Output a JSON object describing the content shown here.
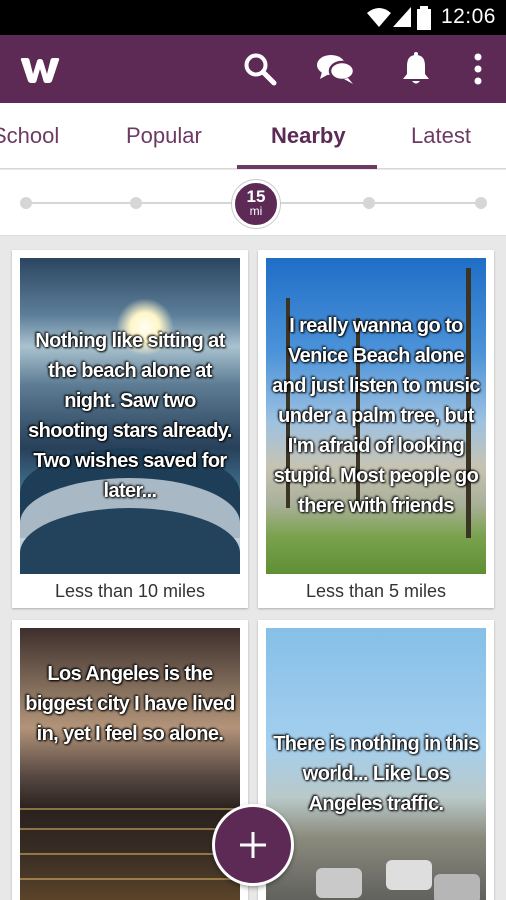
{
  "status_bar": {
    "time": "12:06",
    "icons": [
      "wifi-icon",
      "cellular-signal-icon",
      "battery-icon"
    ]
  },
  "app_bar": {
    "logo": "whisper-w-logo",
    "color": "#5d2a56",
    "actions": [
      {
        "icon": "search-icon"
      },
      {
        "icon": "chat-bubbles-icon"
      },
      {
        "icon": "bell-icon"
      },
      {
        "icon": "more-vertical-icon"
      }
    ]
  },
  "tabs": {
    "items": [
      {
        "label": "School"
      },
      {
        "label": "Popular"
      },
      {
        "label": "Nearby"
      },
      {
        "label": "Latest"
      }
    ],
    "selected": "Nearby"
  },
  "distance_slider": {
    "value": "15",
    "unit": "mi",
    "selected_stop": 3,
    "stop_count": 6
  },
  "feed": {
    "cards": [
      {
        "text": "Nothing like sitting at the beach alone at night.  Saw two shooting stars already. Two wishes saved for later...",
        "distance": "Less than 10 miles",
        "image": "night ocean waves under moon"
      },
      {
        "text": "I really wanna go to Venice Beach alone and just listen to music under a palm tree, but I'm afraid of looking stupid. Most people go there with friends",
        "distance": "Less than 5 miles",
        "image": "palm trees boardwalk Venice Beach"
      },
      {
        "text": "Los Angeles is the biggest city I have lived in, yet I feel so alone.",
        "distance": "",
        "image": "city lights at dusk"
      },
      {
        "text": "There is nothing in this world... Like Los Angeles traffic.",
        "distance": "",
        "image": "freeway traffic"
      }
    ]
  },
  "fab": {
    "icon": "plus-icon"
  }
}
